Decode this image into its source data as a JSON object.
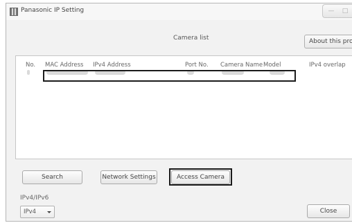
{
  "window": {
    "title": "Panasonic IP Setting"
  },
  "header": {
    "camera_list_title": "Camera list",
    "about_label": "About this progr"
  },
  "table": {
    "columns": [
      "No.",
      "MAC Address",
      "IPv4 Address",
      "Port No.",
      "Camera Name",
      "Model",
      "IPv4 overlap"
    ],
    "rows": [
      {
        "no": "",
        "mac": "",
        "ipv4": "",
        "port": "",
        "camera_name": "",
        "model": "",
        "overlap": ""
      }
    ]
  },
  "buttons": {
    "search": "Search",
    "network_settings": "Network Settings",
    "access_camera": "Access Camera",
    "close": "Close"
  },
  "ip_mode": {
    "label": "IPv4/IPv6",
    "selected": "IPv4"
  },
  "icons": {
    "app": "app-icon",
    "minimize": "minimize-icon",
    "maximize": "maximize-icon",
    "dropdown": "chevron-down-icon"
  }
}
